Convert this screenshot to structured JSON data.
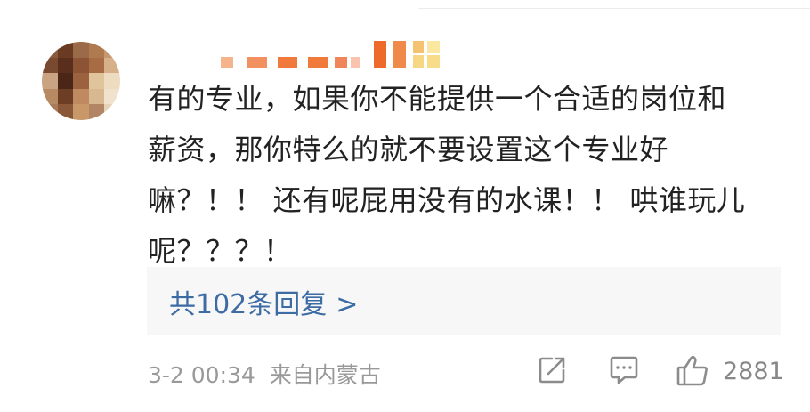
{
  "colors": {
    "text_primary": "#222222",
    "text_secondary": "#999999",
    "link": "#3d6ba3",
    "reply_bg": "#f7f7f7",
    "icon": "#8c8c8c"
  },
  "comment": {
    "avatar_icon": "pixelated-avatar",
    "username_icon": "pixelated-username",
    "lines": [
      "有的专业，如果你不能提供一个合适的岗位和",
      "薪资，那你特么的就不要设置这个专业好",
      "嘛？！！ 还有呢屁用没有的水课！！ 哄谁玩儿",
      "呢？？？！"
    ]
  },
  "replies": {
    "label": "共102条回复",
    "chevron": ">"
  },
  "footer": {
    "datetime": "3-2 00:34",
    "source": "来自内蒙古",
    "like_count": "2881",
    "share_icon": "share-icon",
    "comment_icon": "comment-icon",
    "like_icon": "thumbs-up-icon"
  }
}
